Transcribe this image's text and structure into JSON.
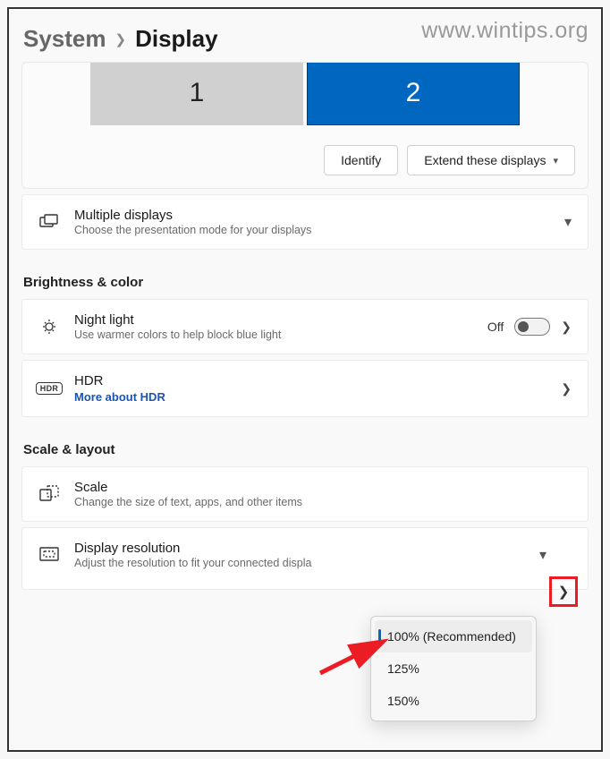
{
  "watermark": "www.wintips.org",
  "breadcrumb": {
    "parent": "System",
    "current": "Display"
  },
  "monitors": {
    "m1": "1",
    "m2": "2"
  },
  "actions": {
    "identify": "Identify",
    "extend": "Extend these displays"
  },
  "multiple": {
    "title": "Multiple displays",
    "sub": "Choose the presentation mode for your displays"
  },
  "section_bc": "Brightness & color",
  "nightlight": {
    "title": "Night light",
    "sub": "Use warmer colors to help block blue light",
    "state": "Off"
  },
  "hdr": {
    "title": "HDR",
    "link": "More about HDR",
    "badge": "HDR"
  },
  "section_sl": "Scale & layout",
  "scale": {
    "title": "Scale",
    "sub": "Change the size of text, apps, and other items"
  },
  "resolution": {
    "title": "Display resolution",
    "sub": "Adjust the resolution to fit your connected displa"
  },
  "dropdown": {
    "opt1": "100% (Recommended)",
    "opt2": "125%",
    "opt3": "150%"
  }
}
